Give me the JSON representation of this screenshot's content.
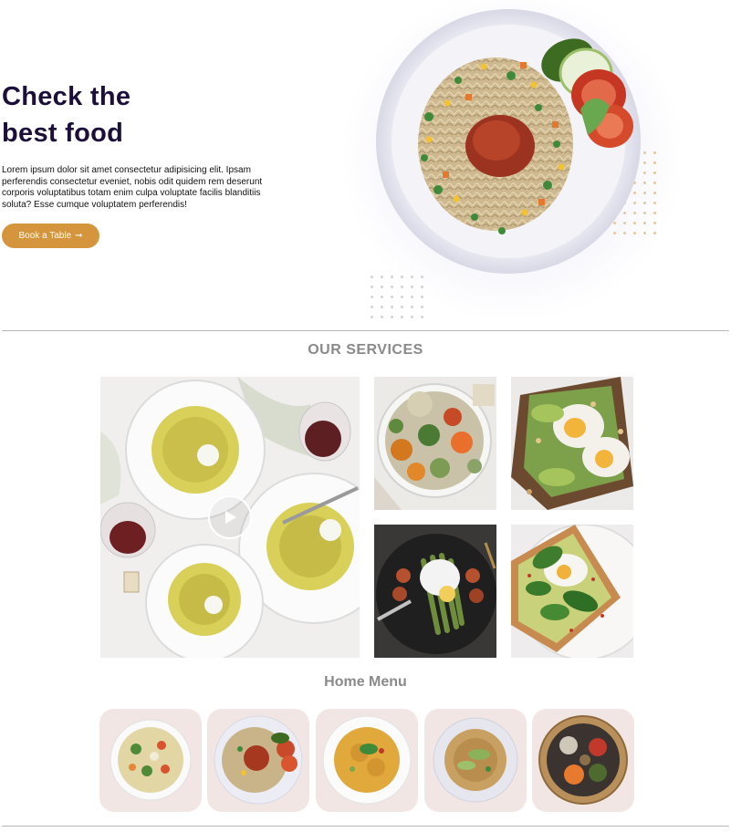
{
  "hero": {
    "title_line1": "Check the",
    "title_line2": "best food",
    "description": "Lorem ipsum dolor sit amet consectetur adipisicing elit. Ipsam perferendis consectetur eveniet, nobis odit quidem rem deserunt corporis voluptatibus totam enim culpa voluptate facilis blanditiis soluta? Esse cumque voluptatem perferendis!",
    "button_label": "Book a Table",
    "button_arrow": "➞",
    "button_icon": "arrow-right-icon",
    "image": "spaghetti-plate-photo"
  },
  "services": {
    "title": "OUR SERVICES",
    "tiles": [
      {
        "name": "pasta-dinner-photo",
        "has_play": true
      },
      {
        "name": "roasted-vegetables-bowl-photo"
      },
      {
        "name": "avocado-egg-toast-photo"
      },
      {
        "name": "asparagus-poached-egg-photo"
      },
      {
        "name": "avocado-spinach-toast-photo"
      }
    ],
    "play_icon": "play-icon"
  },
  "menu": {
    "title": "Home Menu",
    "items": [
      {
        "name": "pasta-salad-dish"
      },
      {
        "name": "spaghetti-tomato-dish"
      },
      {
        "name": "fusilli-pesto-dish"
      },
      {
        "name": "noodles-avocado-dish"
      },
      {
        "name": "rice-bowl-dish"
      }
    ]
  },
  "colors": {
    "title": "#1c0f3a",
    "accent": "#d5953d",
    "section_title": "#8a8a8a",
    "card_bg": "#f1e6e3"
  }
}
